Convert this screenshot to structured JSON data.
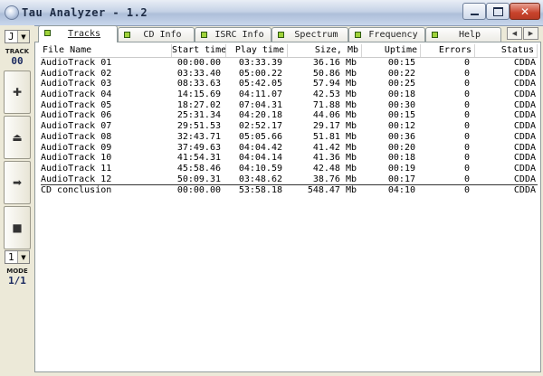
{
  "window": {
    "title": "Tau Analyzer - 1.2"
  },
  "left_panel": {
    "track_select": "J",
    "track_label": "TRACK",
    "track_value": "00",
    "mode_select": "1",
    "mode_label": "MODE",
    "mode_value": "1/1"
  },
  "tabs": [
    {
      "label": "Tracks",
      "active": true
    },
    {
      "label": "CD Info"
    },
    {
      "label": "ISRC Info"
    },
    {
      "label": "Spectrum"
    },
    {
      "label": "Frequency"
    },
    {
      "label": "Help"
    }
  ],
  "table": {
    "columns": [
      "File Name",
      "Start time",
      "Play time",
      "Size, Mb",
      "Uptime",
      "Errors",
      "Status"
    ],
    "rows": [
      [
        "AudioTrack 01",
        "00:00.00",
        "03:33.39",
        "36.16 Mb",
        "00:15",
        "0",
        "CDDA"
      ],
      [
        "AudioTrack 02",
        "03:33.40",
        "05:00.22",
        "50.86 Mb",
        "00:22",
        "0",
        "CDDA"
      ],
      [
        "AudioTrack 03",
        "08:33.63",
        "05:42.05",
        "57.94 Mb",
        "00:25",
        "0",
        "CDDA"
      ],
      [
        "AudioTrack 04",
        "14:15.69",
        "04:11.07",
        "42.53 Mb",
        "00:18",
        "0",
        "CDDA"
      ],
      [
        "AudioTrack 05",
        "18:27.02",
        "07:04.31",
        "71.88 Mb",
        "00:30",
        "0",
        "CDDA"
      ],
      [
        "AudioTrack 06",
        "25:31.34",
        "04:20.18",
        "44.06 Mb",
        "00:15",
        "0",
        "CDDA"
      ],
      [
        "AudioTrack 07",
        "29:51.53",
        "02:52.17",
        "29.17 Mb",
        "00:12",
        "0",
        "CDDA"
      ],
      [
        "AudioTrack 08",
        "32:43.71",
        "05:05.66",
        "51.81 Mb",
        "00:36",
        "0",
        "CDDA"
      ],
      [
        "AudioTrack 09",
        "37:49.63",
        "04:04.42",
        "41.42 Mb",
        "00:20",
        "0",
        "CDDA"
      ],
      [
        "AudioTrack 10",
        "41:54.31",
        "04:04.14",
        "41.36 Mb",
        "00:18",
        "0",
        "CDDA"
      ],
      [
        "AudioTrack 11",
        "45:58.46",
        "04:10.59",
        "42.48 Mb",
        "00:19",
        "0",
        "CDDA"
      ],
      [
        "AudioTrack 12",
        "50:09.31",
        "03:48.62",
        "38.76 Mb",
        "00:17",
        "0",
        "CDDA"
      ]
    ],
    "summary": [
      "CD conclusion",
      "00:00.00",
      "53:58.18",
      "548.47 Mb",
      "04:10",
      "0",
      "CDDA"
    ]
  }
}
